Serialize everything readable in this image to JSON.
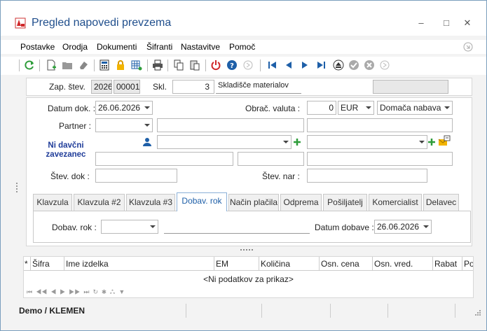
{
  "window": {
    "title": "Pregled napovedi prevzema"
  },
  "menu": [
    "Postavke",
    "Orodja",
    "Dokumenti",
    "Šifranti",
    "Nastavitve",
    "Pomoč"
  ],
  "header": {
    "zap_label": "Zap. štev.",
    "zap_year": "2026",
    "zap_num": "00001",
    "skl_label": "Skl.",
    "skl_value": "3",
    "skl_name": "Skladišče materialov"
  },
  "form": {
    "datum_label": "Datum dok. :",
    "datum_value": "26.06.2026",
    "valuta_label": "Obrač. valuta :",
    "valuta_amount": "0",
    "valuta_currency": "EUR",
    "nabava": "Domača nabava",
    "partner_label": "Partner :",
    "ni_davcni": "Ni davčni zavezanec",
    "stev_dok_label": "Štev. dok :",
    "stev_nar_label": "Štev. nar :"
  },
  "tabs": [
    "Klavzula",
    "Klavzula #2",
    "Klavzula #3",
    "Dobav. rok",
    "Način plačila",
    "Odprema",
    "Pošiljatelj",
    "Komercialist",
    "Delavec"
  ],
  "tab_panel": {
    "dobav_label": "Dobav. rok :",
    "datum_dobave_label": "Datum dobave :",
    "datum_dobave_value": "26.06.2026"
  },
  "grid": {
    "columns": [
      "*",
      "Šifra",
      "Ime izdelka",
      "EM",
      "Količina",
      "Osn. cena",
      "Osn. vred.",
      "Rabat",
      "Po"
    ],
    "empty": "<Ni podatkov za prikaz>"
  },
  "status": {
    "user": "Demo / KLEMEN"
  },
  "colors": {
    "accent": "#1e5fa8",
    "title": "#1f4e8c",
    "green": "#2e9c3a",
    "red": "#d0282a"
  }
}
